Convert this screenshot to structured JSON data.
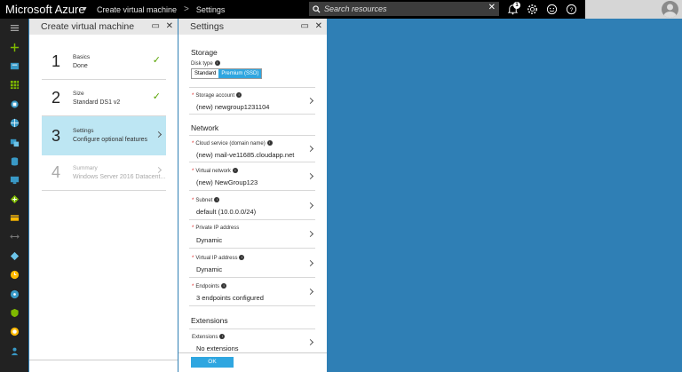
{
  "topbar": {
    "brand": "Microsoft Azure",
    "breadcrumb": [
      "Create virtual machine",
      "Settings"
    ],
    "search_placeholder": "Search resources",
    "notification_count": "1"
  },
  "blade1": {
    "title": "Create virtual machine",
    "steps": [
      {
        "num": "1",
        "title": "Basics",
        "subtitle": "Done"
      },
      {
        "num": "2",
        "title": "Size",
        "subtitle": "Standard DS1 v2"
      },
      {
        "num": "3",
        "title": "Settings",
        "subtitle": "Configure optional features"
      },
      {
        "num": "4",
        "title": "Summary",
        "subtitle": "Windows Server 2016 Datacent..."
      }
    ]
  },
  "blade2": {
    "title": "Settings",
    "storage": {
      "heading": "Storage",
      "disk_type_label": "Disk type",
      "disk_options": [
        "Standard",
        "Premium (SSD)"
      ],
      "storage_account_label": "Storage account",
      "storage_account_value": "(new) newgroup1231104"
    },
    "network": {
      "heading": "Network",
      "fields": [
        {
          "label": "Cloud service (domain name)",
          "value": "(new) mail-ve11685.cloudapp.net"
        },
        {
          "label": "Virtual network",
          "value": "(new) NewGroup123"
        },
        {
          "label": "Subnet",
          "value": "default (10.0.0.0/24)"
        },
        {
          "label": "Private IP address",
          "value": "Dynamic"
        },
        {
          "label": "Virtual IP address",
          "value": "Dynamic"
        },
        {
          "label": "Endpoints",
          "value": "3 endpoints configured"
        }
      ]
    },
    "extensions": {
      "heading": "Extensions",
      "label": "Extensions",
      "value": "No extensions"
    },
    "ok_label": "OK"
  }
}
